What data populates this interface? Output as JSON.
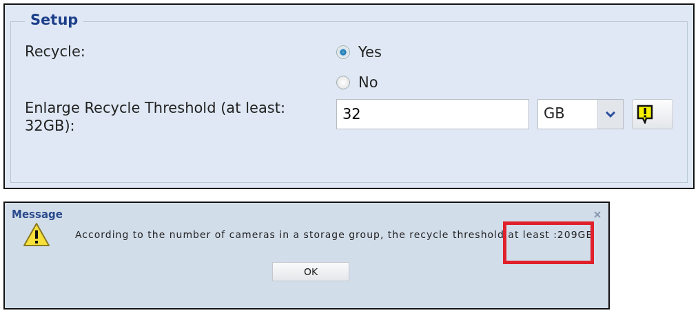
{
  "setup": {
    "legend": "Setup",
    "recycle": {
      "label": "Recycle:",
      "options": [
        {
          "label": "Yes",
          "selected": true
        },
        {
          "label": "No",
          "selected": false
        }
      ]
    },
    "threshold": {
      "label": "Enlarge Recycle Threshold (at least: 32GB):",
      "value": "32",
      "unit": "GB"
    }
  },
  "message": {
    "title": "Message",
    "text": "According to the number of cameras in a storage group, the recycle threshold at least :209GB",
    "button": "OK"
  }
}
